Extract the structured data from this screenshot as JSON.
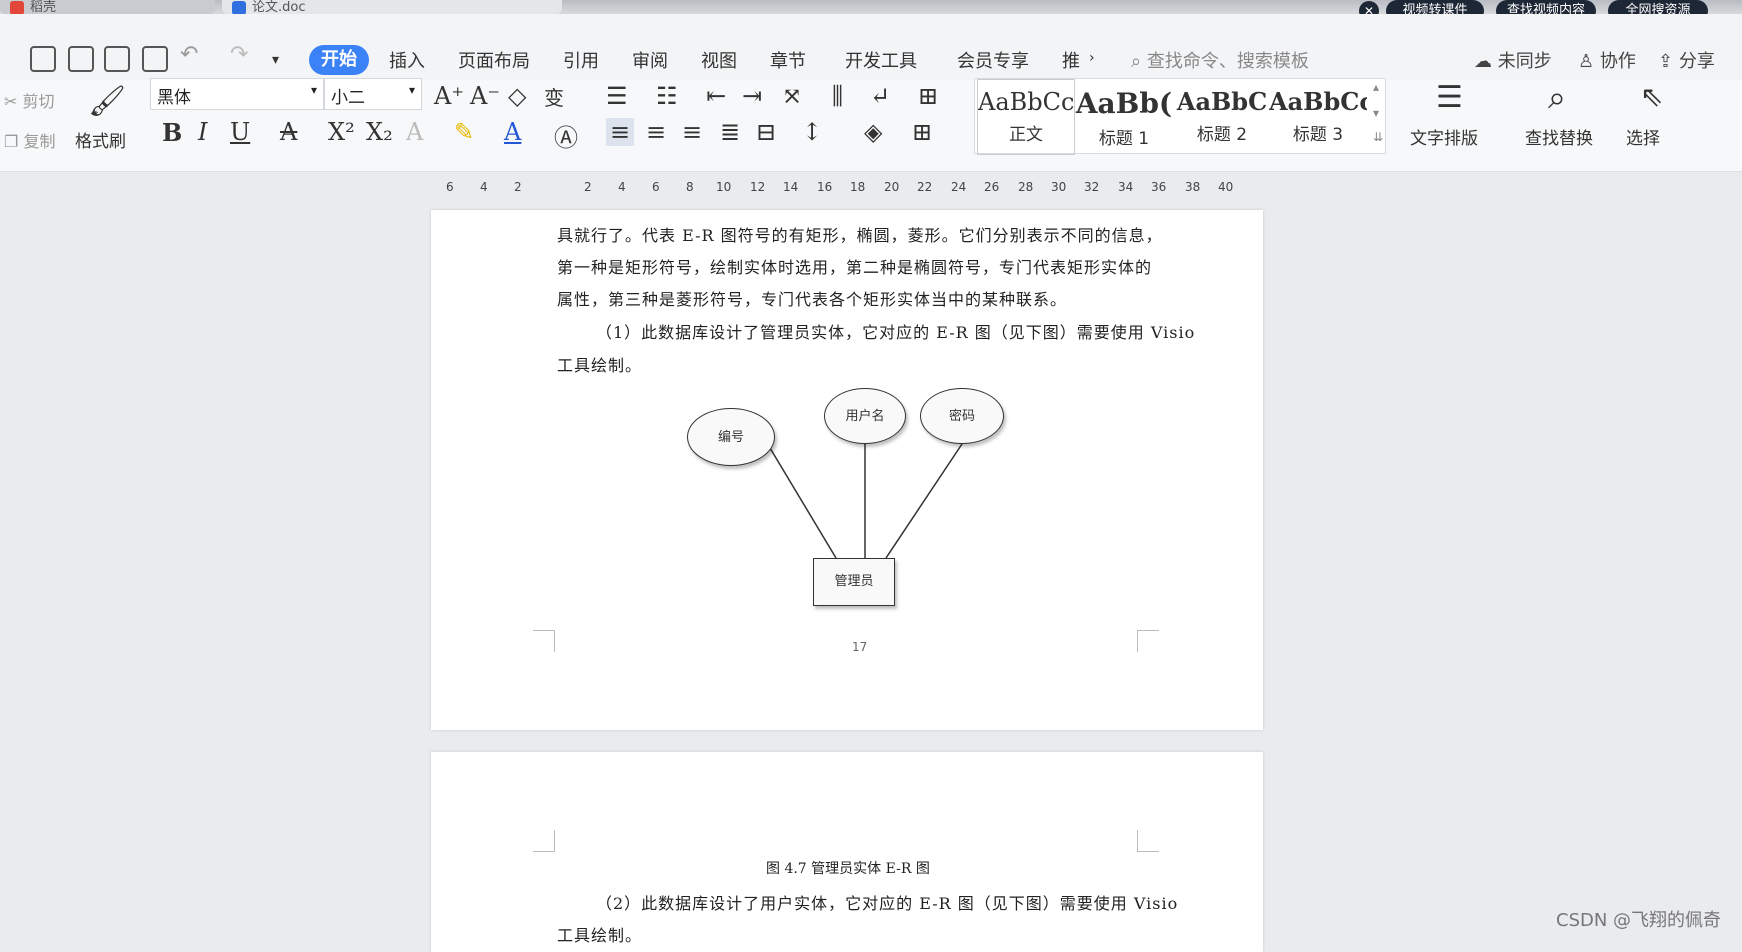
{
  "titlebar": {
    "tabs": [
      "稻壳",
      "论文.doc"
    ],
    "pills": [
      "视频转课件",
      "查找视频内容",
      "全网搜资源"
    ]
  },
  "menu": {
    "items": [
      "开始",
      "插入",
      "页面布局",
      "引用",
      "审阅",
      "视图",
      "章节",
      "开发工具",
      "会员专享",
      "推"
    ],
    "search_placeholder": "查找命令、搜索模板",
    "right_actions": [
      "未同步",
      "协作",
      "分享"
    ]
  },
  "ribbon": {
    "cut": "剪切",
    "copy": "复制",
    "format_painter": "格式刷",
    "font_name": "黑体",
    "font_size": "小二",
    "styles": [
      {
        "sample": "AaBbCcI",
        "name": "正文"
      },
      {
        "sample": "AaBb(",
        "name": "标题 1"
      },
      {
        "sample": "AaBbC",
        "name": "标题 2"
      },
      {
        "sample": "AaBbCcl",
        "name": "标题 3"
      }
    ],
    "text_layout": "文字排版",
    "find_replace": "查找替换",
    "select": "选择"
  },
  "ruler": {
    "ticks": [
      "6",
      "4",
      "2",
      "2",
      "4",
      "6",
      "8",
      "10",
      "12",
      "14",
      "16",
      "18",
      "20",
      "22",
      "24",
      "26",
      "28",
      "30",
      "32",
      "34",
      "36",
      "38",
      "40"
    ]
  },
  "document": {
    "lines": [
      "具就行了。代表 E-R 图符号的有矩形，椭圆，菱形。它们分别表示不同的信息，",
      "第一种是矩形符号，绘制实体时选用，第二种是椭圆符号，专门代表矩形实体的",
      "属性，第三种是菱形符号，专门代表各个矩形实体当中的某种联系。",
      "（1）此数据库设计了管理员实体，它对应的 E-R 图（见下图）需要使用 Visio",
      "工具绘制。"
    ],
    "er": {
      "attributes": [
        "编号",
        "用户名",
        "密码"
      ],
      "entity": "管理员"
    },
    "page_number": "17",
    "caption": "图 4.7 管理员实体 E-R 图",
    "next_lines": [
      "（2）此数据库设计了用户实体，它对应的 E-R 图（见下图）需要使用 Visio",
      "工具绘制。"
    ]
  },
  "watermark": "CSDN @飞翔的佩奇"
}
